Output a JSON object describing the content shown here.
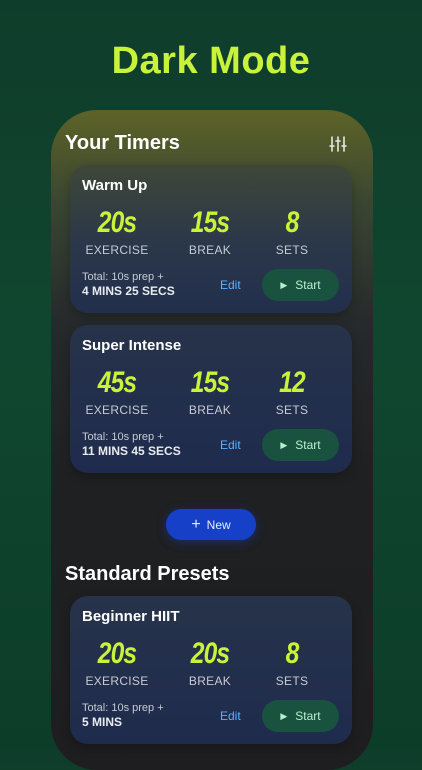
{
  "headline": "Dark Mode",
  "your_timers": {
    "title": "Your Timers",
    "filter_icon": "sliders-icon",
    "cards": [
      {
        "name": "Warm Up",
        "exercise": "20s",
        "exercise_label": "EXERCISE",
        "break": "15s",
        "break_label": "BREAK",
        "sets": "8",
        "sets_label": "SETS",
        "total_line1": "Total: 10s prep +",
        "total_line2": "4 MINS 25 SECS",
        "edit_label": "Edit",
        "start_label": "Start"
      },
      {
        "name": "Super Intense",
        "exercise": "45s",
        "exercise_label": "EXERCISE",
        "break": "15s",
        "break_label": "BREAK",
        "sets": "12",
        "sets_label": "SETS",
        "total_line1": "Total: 10s prep +",
        "total_line2": "11 MINS 45 SECS",
        "edit_label": "Edit",
        "start_label": "Start"
      }
    ]
  },
  "new_button": {
    "label": "New",
    "icon": "plus-icon"
  },
  "standard_presets": {
    "title": "Standard Presets",
    "cards": [
      {
        "name": "Beginner HIIT",
        "exercise": "20s",
        "exercise_label": "EXERCISE",
        "break": "20s",
        "break_label": "BREAK",
        "sets": "8",
        "sets_label": "SETS",
        "total_line1": "Total: 10s prep +",
        "total_line2": "5 MINS",
        "edit_label": "Edit",
        "start_label": "Start"
      }
    ]
  },
  "colors": {
    "background": "#10462f",
    "accent": "#c9f23a",
    "card": "#1e2b4d",
    "start_button": "#19533f",
    "new_button": "#1640c8",
    "link": "#5db0ff"
  }
}
